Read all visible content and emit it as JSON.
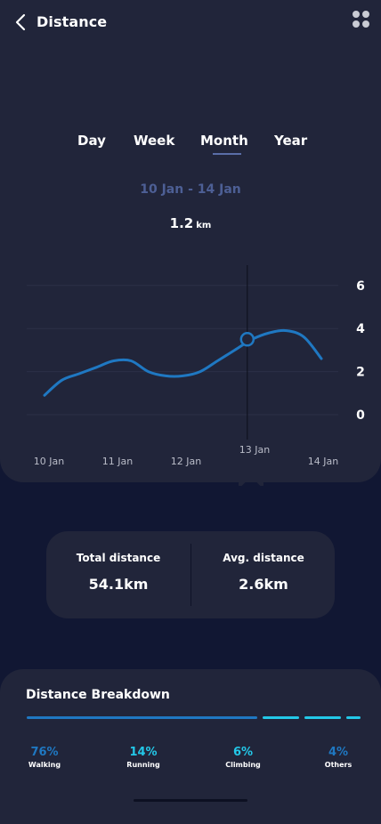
{
  "header": {
    "title": "Distance",
    "back_icon": "chevron-left-icon",
    "menu_icon": "grid-dots-icon"
  },
  "tabs": [
    {
      "label": "Day",
      "active": false
    },
    {
      "label": "Week",
      "active": false
    },
    {
      "label": "Month",
      "active": true
    },
    {
      "label": "Year",
      "active": false
    }
  ],
  "date_range": "10 Jan - 14 Jan",
  "readout": {
    "value": "1.2",
    "unit": "km"
  },
  "chart_data": {
    "type": "line",
    "x": [
      "10 Jan",
      "11 Jan",
      "12 Jan",
      "13 Jan",
      "14 Jan"
    ],
    "y_ticks": [
      0,
      2,
      4,
      6
    ],
    "ylim": [
      0,
      6
    ],
    "series": [
      {
        "x": [
          10.0,
          10.25,
          10.5,
          10.75,
          11.0,
          11.25,
          11.5,
          11.75,
          12.0,
          12.25,
          12.5,
          12.75,
          13.0,
          13.25,
          13.5,
          13.75,
          14.0
        ],
        "values": [
          0.9,
          1.6,
          1.9,
          2.2,
          2.5,
          2.5,
          2.0,
          1.8,
          1.8,
          2.0,
          2.5,
          3.0,
          3.5,
          3.8,
          3.9,
          3.6,
          2.6
        ]
      }
    ],
    "selected": {
      "x": "13 Jan",
      "value": 3.5
    },
    "grid": true,
    "colors": {
      "line": "#1f78c2",
      "grid": "#2c3047",
      "cursor": "#0b0e1a"
    }
  },
  "stats": {
    "total": {
      "label": "Total distance",
      "value": "54.1km"
    },
    "average": {
      "label": "Avg. distance",
      "value": "2.6km"
    }
  },
  "breakdown": {
    "title": "Distance Breakdown",
    "items": [
      {
        "percent": "76%",
        "label": "Walking",
        "color": "#1f78c2"
      },
      {
        "percent": "14%",
        "label": "Running",
        "color": "#23c8e8"
      },
      {
        "percent": "6%",
        "label": "Climbing",
        "color": "#23c8e8"
      },
      {
        "percent": "4%",
        "label": "Others",
        "color": "#1f78c2"
      }
    ],
    "bar_colors": [
      "#1f78c2",
      "#23c8e8",
      "#23c8e8",
      "#23c8e8"
    ]
  }
}
